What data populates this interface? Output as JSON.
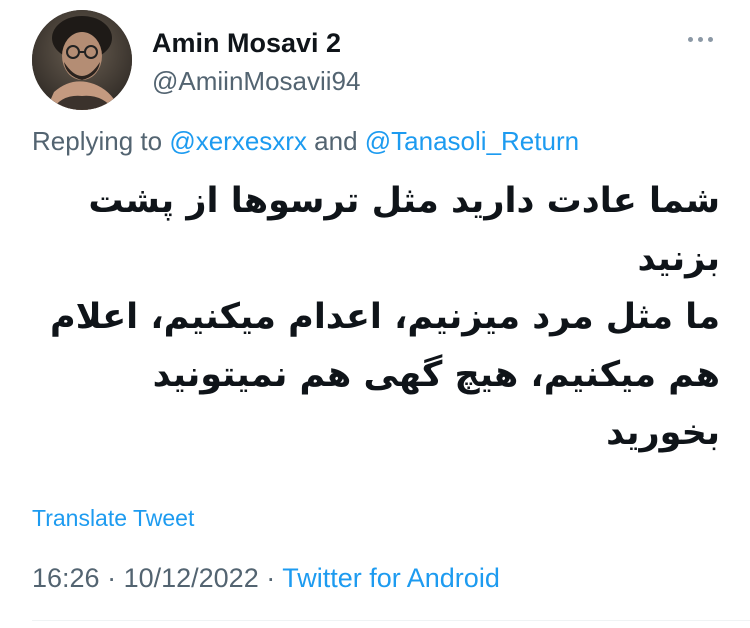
{
  "author": {
    "display_name": "Amin Mosavi 2",
    "handle": "@AmiinMosavii94"
  },
  "replying": {
    "prefix": "Replying to ",
    "mention_1": "@xerxesxrx",
    "joiner": " and ",
    "mention_2": "@Tanasoli_Return"
  },
  "tweet": {
    "lines": [
      "شما عادت دارید مثل ترسوها از پشت",
      "بزنید",
      "ما مثل مرد میزنیم، اعدام میکنیم، اعلام",
      "هم میکنیم، هیچ گهی هم نمیتونید",
      "بخورید"
    ]
  },
  "translate_label": "Translate Tweet",
  "meta": {
    "time": "16:26",
    "separator": " · ",
    "date": "10/12/2022",
    "source": "Twitter for Android"
  },
  "colors": {
    "accent": "#1d9bf0",
    "secondary_text": "#536471",
    "primary_text": "#0f1419"
  },
  "icons": {
    "more": "more-horizontal-icon"
  }
}
